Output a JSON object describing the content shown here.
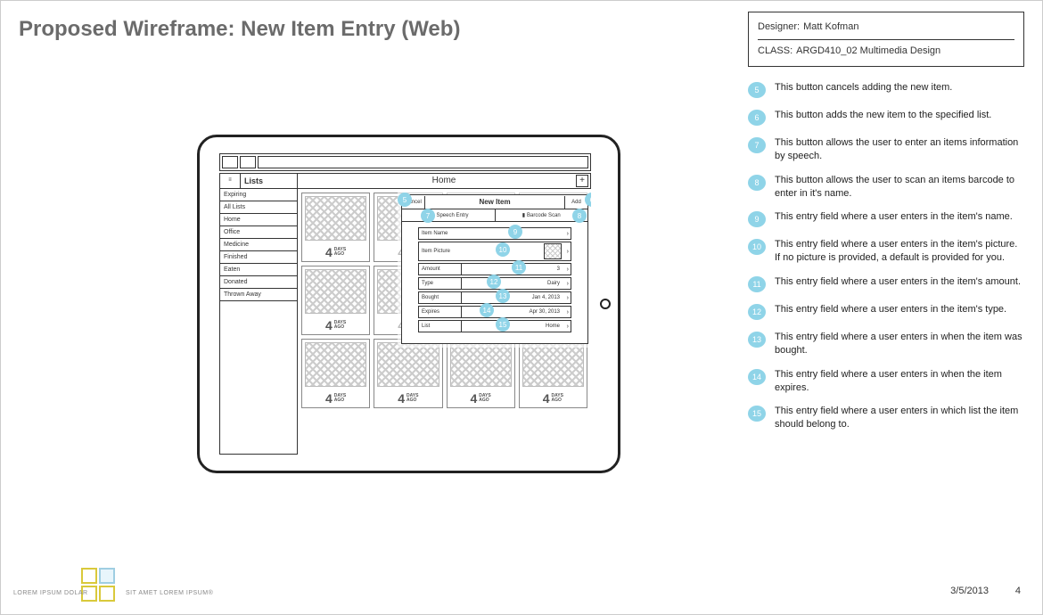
{
  "page_title": "Proposed Wireframe: New Item Entry (Web)",
  "info": {
    "designer_label": "Designer:",
    "designer_value": "Matt Kofman",
    "class_label": "CLASS:",
    "class_value": "ARGD410_02 Multimedia Design"
  },
  "annotations": [
    {
      "n": "5",
      "text": "This button cancels adding the new item."
    },
    {
      "n": "6",
      "text": "This button adds the new item to the specified list."
    },
    {
      "n": "7",
      "text": "This button allows the user to enter an items information by speech."
    },
    {
      "n": "8",
      "text": "This button allows the user to scan an items barcode to enter in it's name."
    },
    {
      "n": "9",
      "text": "This entry field where a user enters in the item's name."
    },
    {
      "n": "10",
      "text": "This entry field where a user enters in the item's picture. If no picture is provided, a default is provided for you."
    },
    {
      "n": "11",
      "text": "This entry field where a user enters in the item's amount."
    },
    {
      "n": "12",
      "text": "This entry field where a user enters in the item's type."
    },
    {
      "n": "13",
      "text": "This entry field where a user enters in when the item was bought."
    },
    {
      "n": "14",
      "text": "This entry field where a user enters in when the item expires."
    },
    {
      "n": "15",
      "text": "This entry field where a user enters in which list the item should belong to."
    }
  ],
  "app": {
    "lists_label": "Lists",
    "home_label": "Home",
    "plus": "+",
    "sidebar": [
      "Expiring",
      "All Lists",
      "Home",
      "Office",
      "Medicine",
      "Finished",
      "Eaten",
      "Donated",
      "Thrown Away"
    ],
    "card_num": "4",
    "card_days": "DAYS",
    "card_ago": "AGO"
  },
  "modal": {
    "cancel": "Cancel",
    "title": "New Item",
    "add": "Add",
    "speech": "Speech Entry",
    "barcode": "Barcode Scan",
    "fields": {
      "name": "Item Name",
      "picture": "Item Picture",
      "amount_l": "Amount",
      "amount_v": "3",
      "type_l": "Type",
      "type_v": "Dairy",
      "bought_l": "Bought",
      "bought_v": "Jan 4, 2013",
      "expires_l": "Expires",
      "expires_v": "Apr 30, 2013",
      "list_l": "List",
      "list_v": "Home"
    }
  },
  "footer": {
    "left1": "LOREM IPSUM DOLAR",
    "left2": "SIT AMET LOREM IPSUM®",
    "date": "3/5/2013",
    "page": "4"
  }
}
